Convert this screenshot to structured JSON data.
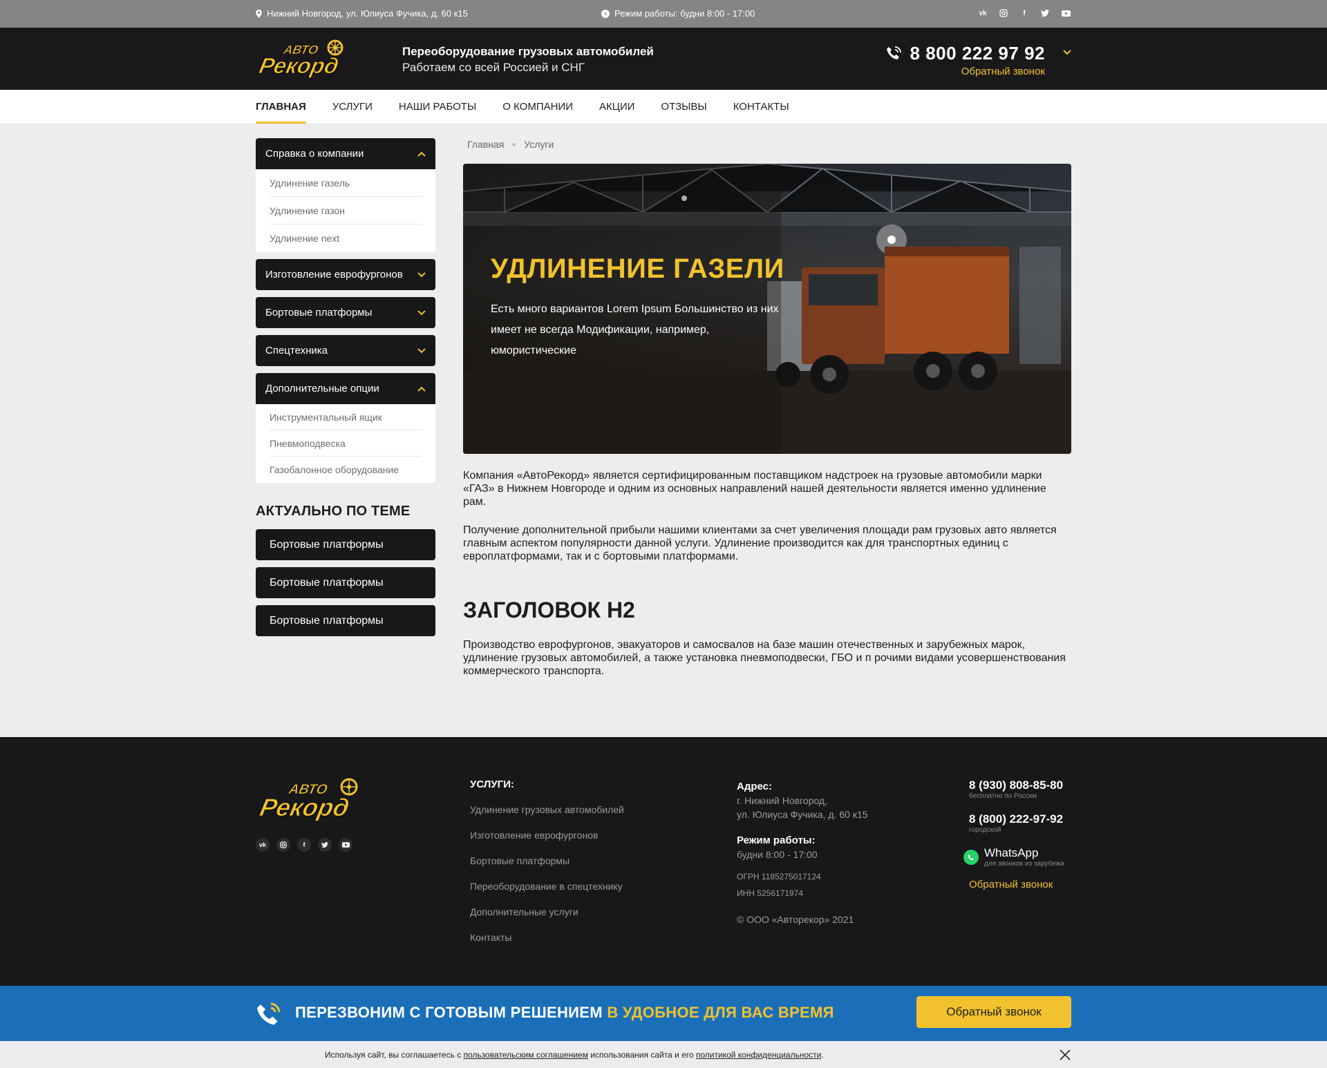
{
  "topbar": {
    "address": "Нижний Новгород, ул. Юлиуса Фучика, д. 60 к15",
    "hours": "Режим работы: будни 8:00 - 17:00",
    "socials": [
      "vk",
      "instagram",
      "facebook",
      "twitter",
      "youtube"
    ]
  },
  "header": {
    "logo_text": "Авто Рекорд",
    "tagline_1": "Переоборудование грузовых автомобилей",
    "tagline_2": "Работаем со всей Россией и СНГ",
    "phone": "8 800 222 97 92",
    "callback": "Обратный звонок"
  },
  "nav": [
    "ГЛАВНАЯ",
    "УСЛУГИ",
    "НАШИ РАБОТЫ",
    "О КОМПАНИИ",
    "АКЦИИ",
    "ОТЗЫВЫ",
    "КОНТАКТЫ"
  ],
  "sidebar": {
    "groups": [
      {
        "label": "Справка о компании",
        "open": true,
        "items": [
          "Удлинение газель",
          "Удлинение газон",
          "Удлинение next"
        ]
      },
      {
        "label": "Изготовление еврофургонов",
        "open": false,
        "items": []
      },
      {
        "label": "Бортовые платформы",
        "open": false,
        "items": []
      },
      {
        "label": "Спецтехника",
        "open": false,
        "items": []
      },
      {
        "label": "Дополнительные опции",
        "open": true,
        "items": [
          "Инструментальный ящик",
          "Пневмоподвеска",
          "Газобалонное оборудование"
        ]
      }
    ],
    "related_title": "АКТУАЛЬНО ПО ТЕМЕ",
    "related": [
      "Бортовые платформы",
      "Бортовые платформы",
      "Бортовые платформы"
    ]
  },
  "breadcrumbs": [
    "Главная",
    "Услуги"
  ],
  "hero": {
    "title": "УДЛИНЕНИЕ ГАЗЕЛИ",
    "text": "Есть много вариантов Lorem Ipsum Большинство из них имеет не всегда Модификации, например, юмористические"
  },
  "content": {
    "p1": "Компания «АвтоРекорд» является сертифицированным поставщиком надстроек на грузовые автомобили марки «ГАЗ» в Нижнем Новгороде и одним из основных направлений нашей деятельности является именно удлинение рам.",
    "p2": "Получение дополнительной прибыли нашими клиентами за счет увеличения площади рам грузовых авто является главным аспектом популярности данной услуги. Удлинение производится как для транспортных единиц с европлатформами, так и с бортовыми платформами.",
    "h2": "ЗАГОЛОВОК H2",
    "p3": "Производство еврофургонов, эвакуаторов и самосвалов на базе машин отечественных и зарубежных марок, удлинение грузовых автомобилей, а также установка пневмоподвески, ГБО и п рочими видами усовершенствования коммерческого транспорта."
  },
  "footer": {
    "services_title": "УСЛУГИ:",
    "services": [
      "Удлинение грузовых автомобилей",
      "Изготовление еврофургонов",
      "Бортовые платформы",
      "Переоборудование в спецтехнику",
      "Дополнительные услуги",
      "Контакты"
    ],
    "address_label": "Адрес:",
    "address_1": "г. Нижний Новгород,",
    "address_2": "ул. Юлиуса Фучика, д. 60 к15",
    "hours_label": "Режим работы:",
    "hours": "будни  8:00 - 17:00",
    "ogrn": "ОГРН 1185275017124",
    "inn": "ИНН 5256171974",
    "copyright": "© ООО «Авторекор» 2021",
    "phone_1": "8 (930) 808-85-80",
    "phone_1_sub": "бесплатно по России",
    "phone_2": "8 (800) 222-97-92",
    "phone_2_sub": "городской",
    "whatsapp": "WhatsApp",
    "whatsapp_sub": "для звонков из зарубежа",
    "callback": "Обратный звонок"
  },
  "banner": {
    "text_white": "ПЕРЕЗВОНИМ С ГОТОВЫМ РЕШЕНИЕМ",
    "text_yellow": "В УДОБНОЕ ДЛЯ ВАС ВРЕМЯ",
    "button": "Обратный звонок"
  },
  "cookie": {
    "pre": "Используя  сайт, вы соглашаетесь с ",
    "link1": "пользовательским соглашением",
    "mid": "  использования сайта и его  ",
    "link2": "политикой конфиденциальности",
    "post": "."
  },
  "colors": {
    "accent": "#f1c22e",
    "dark": "#18181a",
    "banner": "#1a6fb8"
  }
}
